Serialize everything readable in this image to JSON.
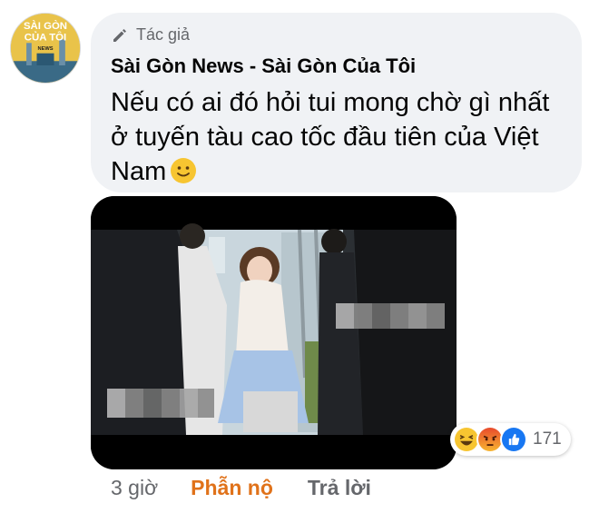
{
  "post": {
    "avatar_icon": "saigon-news-logo",
    "avatar_logo_text": [
      "SÀI GÒN",
      "CỦA TÔI",
      "NEWS"
    ],
    "author_badge": "Tác giả",
    "author_name": "Sài Gòn News - Sài Gòn Của Tôi",
    "comment_text": "Nếu có ai đó hỏi tui mong chờ gì nhất ở tuyến tàu cao tốc đầu tiên của Việt Nam",
    "comment_emoji": "slightly-smiling-face",
    "media_icon": "train-photo"
  },
  "reactions": {
    "icons": [
      "haha-icon",
      "angry-icon",
      "like-icon"
    ],
    "count": "171"
  },
  "actions": {
    "time": "3 giờ",
    "reaction": "Phẫn nộ",
    "reply": "Trả lời"
  },
  "colors": {
    "bubble": "#f0f2f5",
    "angry": "#e0721a",
    "secondary_text": "#65676b",
    "like": "#1877f2"
  }
}
